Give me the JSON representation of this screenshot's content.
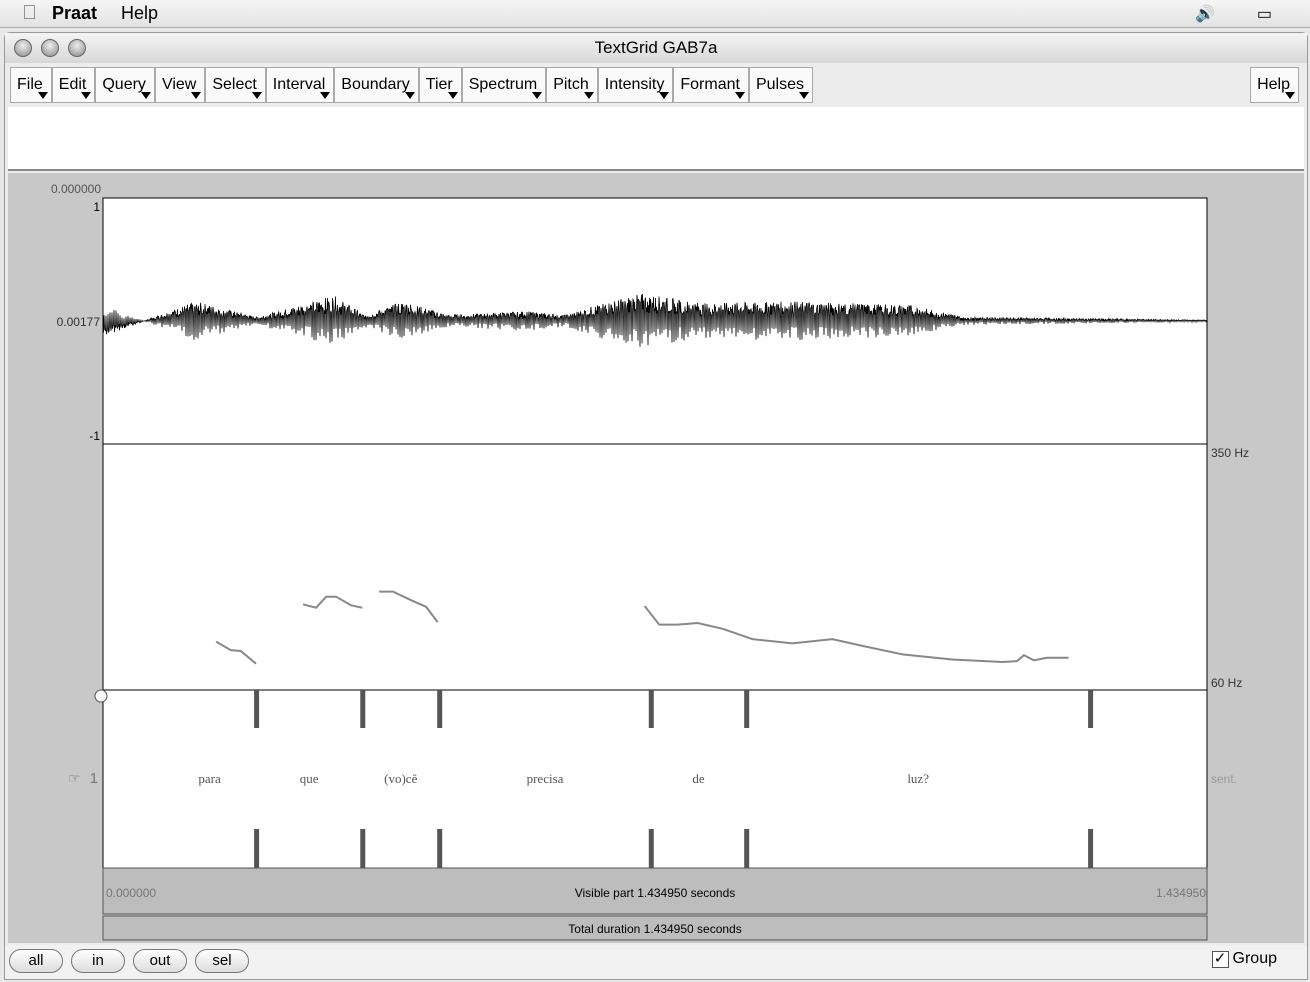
{
  "menubar": {
    "app": "Praat",
    "help": "Help",
    "icons": [
      "apple-icon",
      "volume-icon",
      "battery-icon"
    ]
  },
  "window": {
    "title": "TextGrid GAB7a"
  },
  "menus": [
    "File",
    "Edit",
    "Query",
    "View",
    "Select",
    "Interval",
    "Boundary",
    "Tier",
    "Spectrum",
    "Pitch",
    "Intensity",
    "Formant",
    "Pulses"
  ],
  "help_menu": "Help",
  "waveform": {
    "start_time": "0.000000",
    "top": "1",
    "middle": "0.00177",
    "bottom": "-1"
  },
  "pitch": {
    "top_label": "350 Hz",
    "bottom_label": "60 Hz",
    "range_hz": [
      60,
      350
    ],
    "contour_seconds_hz": [
      [
        [
          0.147,
          117
        ],
        [
          0.166,
          107
        ],
        [
          0.179,
          106
        ],
        [
          0.199,
          91
        ]
      ],
      [
        [
          0.26,
          161
        ],
        [
          0.277,
          157
        ],
        [
          0.29,
          170
        ],
        [
          0.303,
          170
        ],
        [
          0.322,
          160
        ],
        [
          0.337,
          157
        ]
      ],
      [
        [
          0.359,
          176
        ],
        [
          0.377,
          176
        ],
        [
          0.4,
          166
        ],
        [
          0.42,
          158
        ],
        [
          0.435,
          140
        ]
      ],
      [
        [
          0.704,
          159
        ],
        [
          0.723,
          137
        ],
        [
          0.747,
          137
        ],
        [
          0.773,
          139
        ],
        [
          0.806,
          132
        ],
        [
          0.844,
          120
        ],
        [
          0.896,
          115
        ],
        [
          0.948,
          120
        ],
        [
          0.987,
          112
        ],
        [
          1.039,
          102
        ],
        [
          1.104,
          96
        ],
        [
          1.169,
          93
        ],
        [
          1.188,
          94
        ],
        [
          1.197,
          101
        ],
        [
          1.21,
          95
        ],
        [
          1.227,
          98
        ],
        [
          1.255,
          98
        ]
      ]
    ]
  },
  "tier": {
    "number": "1",
    "name": "sent.",
    "boundaries_seconds": [
      0.199,
      0.337,
      0.437,
      0.712,
      0.836,
      1.283
    ],
    "intervals": [
      "para",
      "que",
      "(vo)cê",
      "precisa",
      "de",
      "luz?",
      ""
    ]
  },
  "time": {
    "start": "0.000000",
    "end": "1.434950",
    "duration": 1.43495,
    "visible": "Visible part 1.434950 seconds",
    "total": "Total duration 1.434950 seconds"
  },
  "buttons": {
    "all": "all",
    "in": "in",
    "out": "out",
    "sel": "sel"
  },
  "group": {
    "label": "Group",
    "checked": true
  }
}
